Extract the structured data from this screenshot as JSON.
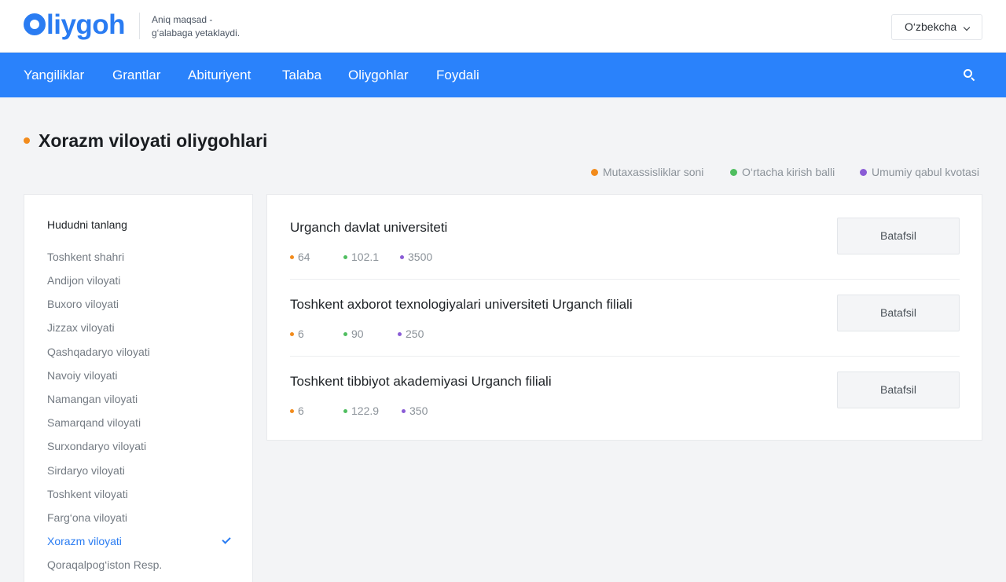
{
  "header": {
    "logo_text": "liygoh",
    "tagline_line1": "Aniq maqsad -",
    "tagline_line2": "g‘alabaga yetaklaydi.",
    "language": "O‘zbekcha"
  },
  "nav": {
    "items": [
      "Yangiliklar",
      "Grantlar",
      "Abituriyent",
      "Talaba",
      "Oliygohlar",
      "Foydali"
    ]
  },
  "page": {
    "title": "Xorazm viloyati oliygohlari"
  },
  "legend": {
    "items": [
      {
        "label": "Mutaxassisliklar soni",
        "color": "#f28b1c"
      },
      {
        "label": "O‘rtacha kirish balli",
        "color": "#4fbe5f"
      },
      {
        "label": "Umumiy qabul kvotasi",
        "color": "#8a5cd6"
      }
    ]
  },
  "sidebar": {
    "title": "Hududni tanlang",
    "items": [
      "Toshkent shahri",
      "Andijon viloyati",
      "Buxoro viloyati",
      "Jizzax viloyati",
      "Qashqadaryo viloyati",
      "Navoiy viloyati",
      "Namangan viloyati",
      "Samarqand viloyati",
      "Surxondaryo viloyati",
      "Sirdaryo viloyati",
      "Toshkent viloyati",
      "Farg‘ona viloyati",
      "Xorazm viloyati",
      "Qoraqalpog‘iston Resp."
    ],
    "selected": "Xorazm viloyati"
  },
  "universities": [
    {
      "name": "Urganch davlat universiteti",
      "specialties": "64",
      "avg_score": "102.1",
      "quota": "3500",
      "button": "Batafsil"
    },
    {
      "name": "Toshkent axborot texnologiyalari universiteti Urganch filiali",
      "specialties": "6",
      "avg_score": "90",
      "quota": "250",
      "button": "Batafsil"
    },
    {
      "name": "Toshkent tibbiyot akademiyasi Urganch filiali",
      "specialties": "6",
      "avg_score": "122.9",
      "quota": "350",
      "button": "Batafsil"
    }
  ],
  "colors": {
    "brand": "#2a7cf2",
    "navbar": "#2a82fb",
    "orange": "#f28b1c",
    "green": "#4fbe5f",
    "purple": "#8a5cd6"
  }
}
